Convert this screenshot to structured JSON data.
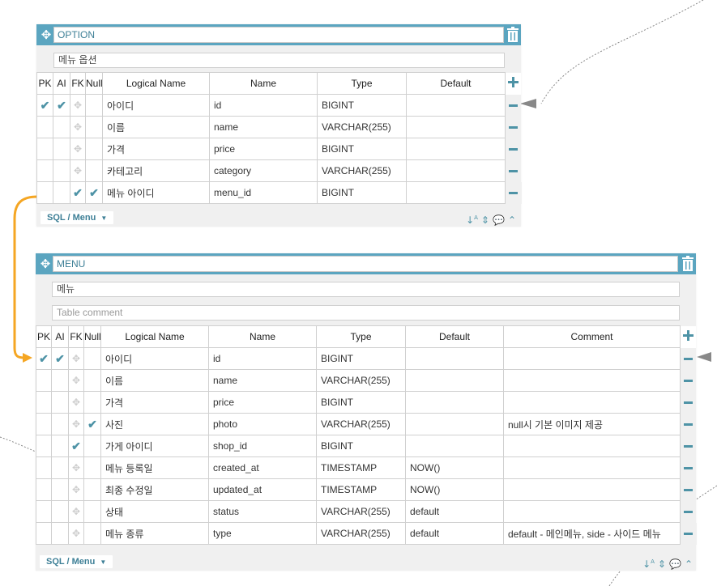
{
  "tables": [
    {
      "name": "OPTION",
      "comment": "메뉴 옵션",
      "comment_placeholder": "",
      "db_label": "SQL / Menu",
      "headers": [
        "PK",
        "AI",
        "FK",
        "Null",
        "Logical Name",
        "Name",
        "Type",
        "Default"
      ],
      "rows": [
        {
          "pk": true,
          "ai": true,
          "fk": false,
          "nul": false,
          "logical": "아이디",
          "name": "id",
          "type": "BIGINT",
          "default": ""
        },
        {
          "pk": false,
          "ai": false,
          "fk": false,
          "nul": false,
          "logical": "이름",
          "name": "name",
          "type": "VARCHAR(255)",
          "default": ""
        },
        {
          "pk": false,
          "ai": false,
          "fk": false,
          "nul": false,
          "logical": "가격",
          "name": "price",
          "type": "BIGINT",
          "default": ""
        },
        {
          "pk": false,
          "ai": false,
          "fk": false,
          "nul": false,
          "logical": "카테고리",
          "name": "category",
          "type": "VARCHAR(255)",
          "default": ""
        },
        {
          "pk": false,
          "ai": false,
          "fk": true,
          "nul": true,
          "logical": "메뉴 아이디",
          "name": "menu_id",
          "type": "BIGINT",
          "default": ""
        }
      ]
    },
    {
      "name": "MENU",
      "comment": "메뉴",
      "comment_placeholder": "Table comment",
      "db_label": "SQL / Menu",
      "headers": [
        "PK",
        "AI",
        "FK",
        "Null",
        "Logical Name",
        "Name",
        "Type",
        "Default",
        "Comment"
      ],
      "rows": [
        {
          "pk": true,
          "ai": true,
          "fk": false,
          "nul": false,
          "logical": "아이디",
          "name": "id",
          "type": "BIGINT",
          "default": "",
          "comment": ""
        },
        {
          "pk": false,
          "ai": false,
          "fk": false,
          "nul": false,
          "logical": "이름",
          "name": "name",
          "type": "VARCHAR(255)",
          "default": "",
          "comment": ""
        },
        {
          "pk": false,
          "ai": false,
          "fk": false,
          "nul": false,
          "logical": "가격",
          "name": "price",
          "type": "BIGINT",
          "default": "",
          "comment": ""
        },
        {
          "pk": false,
          "ai": false,
          "fk": false,
          "nul": true,
          "logical": "사진",
          "name": "photo",
          "type": "VARCHAR(255)",
          "default": "",
          "comment": "null시 기본 이미지 제공"
        },
        {
          "pk": false,
          "ai": false,
          "fk": true,
          "nul": false,
          "logical": "가게 아이디",
          "name": "shop_id",
          "type": "BIGINT",
          "default": "",
          "comment": ""
        },
        {
          "pk": false,
          "ai": false,
          "fk": false,
          "nul": false,
          "logical": "메뉴 등록일",
          "name": "created_at",
          "type": "TIMESTAMP",
          "default": "NOW()",
          "comment": ""
        },
        {
          "pk": false,
          "ai": false,
          "fk": false,
          "nul": false,
          "logical": "최종 수정일",
          "name": "updated_at",
          "type": "TIMESTAMP",
          "default": "NOW()",
          "comment": ""
        },
        {
          "pk": false,
          "ai": false,
          "fk": false,
          "nul": false,
          "logical": "상태",
          "name": "status",
          "type": "VARCHAR(255)",
          "default": "default",
          "comment": ""
        },
        {
          "pk": false,
          "ai": false,
          "fk": false,
          "nul": false,
          "logical": "메뉴 종류",
          "name": "type",
          "type": "VARCHAR(255)",
          "default": "default",
          "comment": "default - 메인메뉴, side - 사이드 메뉴"
        }
      ]
    }
  ],
  "icons": {
    "check": "check-icon",
    "fk_move": "move-icon",
    "add": "plus-icon",
    "remove": "minus-icon",
    "trash": "trash-icon",
    "sort": "sort-icon",
    "updown": "updown-icon",
    "memo": "comment-icon",
    "collapse": "chevron-up-icon"
  },
  "colors": {
    "accent": "#5ba5c0",
    "check": "#4e93a6",
    "relation": "#f5a623",
    "line": "#9a9a9a"
  }
}
